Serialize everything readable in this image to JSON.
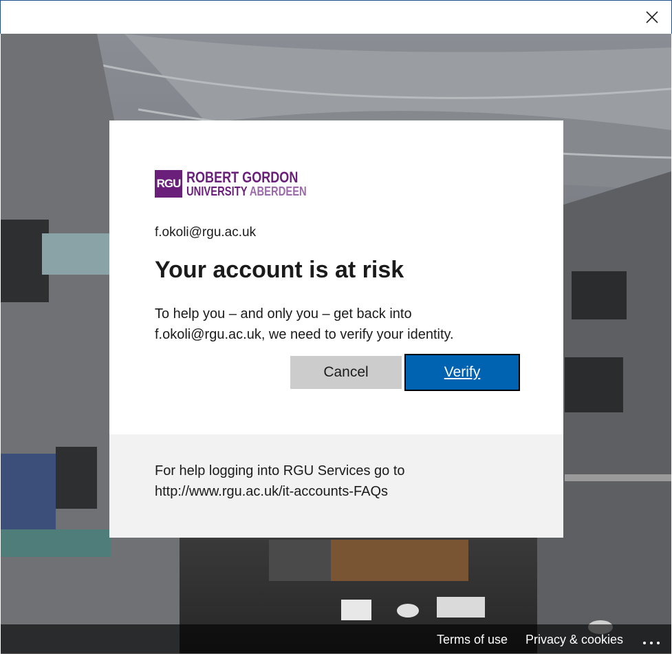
{
  "window": {
    "close_icon": "close-icon"
  },
  "brand": {
    "badge": "RGU",
    "line1": "ROBERT GORDON",
    "line2_part1": "UNIVERSITY ",
    "line2_part2": "ABERDEEN",
    "color_primary": "#6a1f7a",
    "color_accent": "#9b6aa8"
  },
  "dialog": {
    "email": "f.okoli@rgu.ac.uk",
    "title": "Your account is at risk",
    "description": "To help you – and only you – get back into f.okoli@rgu.ac.uk, we need to verify your identity.",
    "cancel_label": "Cancel",
    "verify_label": "Verify",
    "verify_color": "#0063b1"
  },
  "help": {
    "text_line1": "For help logging into RGU Services go to",
    "text_line2": "http://www.rgu.ac.uk/it-accounts-FAQs"
  },
  "footer": {
    "terms_label": "Terms of use",
    "privacy_label": "Privacy & cookies",
    "more_icon": "more-options-icon"
  }
}
